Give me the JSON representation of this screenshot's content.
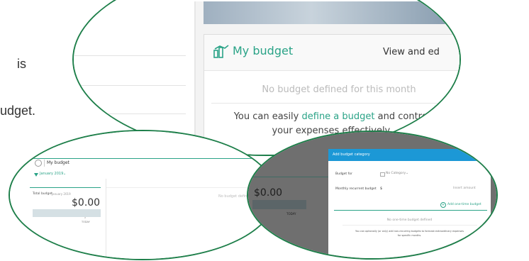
{
  "background": {
    "text_line1": "is",
    "text_line2": "udget."
  },
  "bubble_top": {
    "title": "My budget",
    "view_link": "View and ed",
    "empty_message": "No budget defined for this month",
    "cta_prefix": "You can easily ",
    "cta_link": "define a budget",
    "cta_suffix": " and control",
    "cta_line2": "your expenses effectively."
  },
  "bubble_left": {
    "title": "My budget",
    "month": "January 2019",
    "total_label": "Total budget",
    "total_month": "January 2019",
    "amount": "$0.00",
    "today_label": "TODAY",
    "no_budget": "No budget defined"
  },
  "bubble_right": {
    "amount": "$0.00",
    "today_label": "TODAY",
    "dialog_title": "Add budget category",
    "budget_for_label": "Budget for",
    "category_value": "No Category",
    "recurrent_label": "Monthly recurrent budget",
    "currency": "$",
    "amount_placeholder": "Insert amount",
    "add_one_time": "Add one-time budget",
    "no_one_time": "No one-time budget defined",
    "hint_line1": "You can optionally (or only) add non-recurring budgets to forecast extraordinary expenses",
    "hint_line2": "for specific months."
  },
  "colors": {
    "accent_green": "#1e7f4a",
    "brand_teal": "#2aa387",
    "dialog_blue": "#1c98d6"
  }
}
